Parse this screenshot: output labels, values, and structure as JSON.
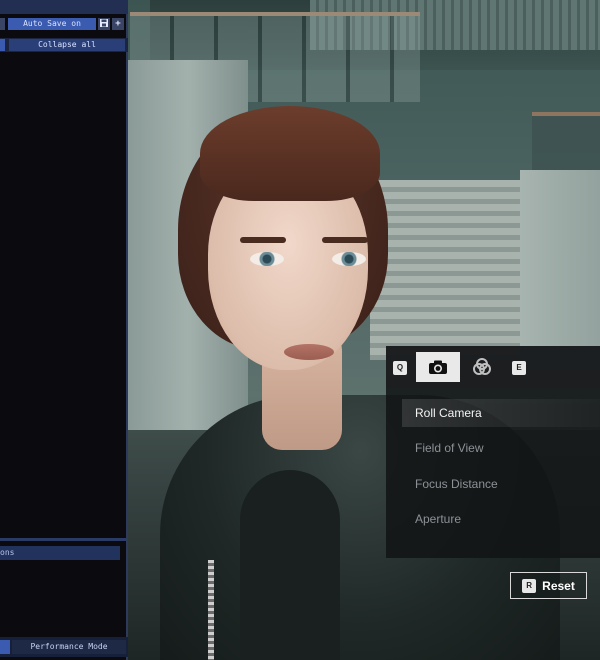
{
  "editor_panel": {
    "auto_save_label": "Auto Save on",
    "save_icon": "floppy-disk-icon",
    "add_icon": "plus-icon",
    "collapse_all_label": "Collapse all",
    "options_label": "ons",
    "performance_mode_label": "Performance Mode"
  },
  "camera_tool": {
    "prev_key": "Q",
    "next_key": "E",
    "tabs": [
      {
        "icon": "camera-icon",
        "active": true
      },
      {
        "icon": "color-filter-icon",
        "active": false
      }
    ],
    "items": [
      {
        "label": "Roll Camera",
        "selected": true
      },
      {
        "label": "Field of View",
        "selected": false
      },
      {
        "label": "Focus Distance",
        "selected": false
      },
      {
        "label": "Aperture",
        "selected": false
      }
    ],
    "reset_key": "R",
    "reset_label": "Reset"
  },
  "colors": {
    "panel_accent": "#3b5bb0",
    "overlay_bg": "#121416",
    "active_tab": "#e9e9e9"
  }
}
